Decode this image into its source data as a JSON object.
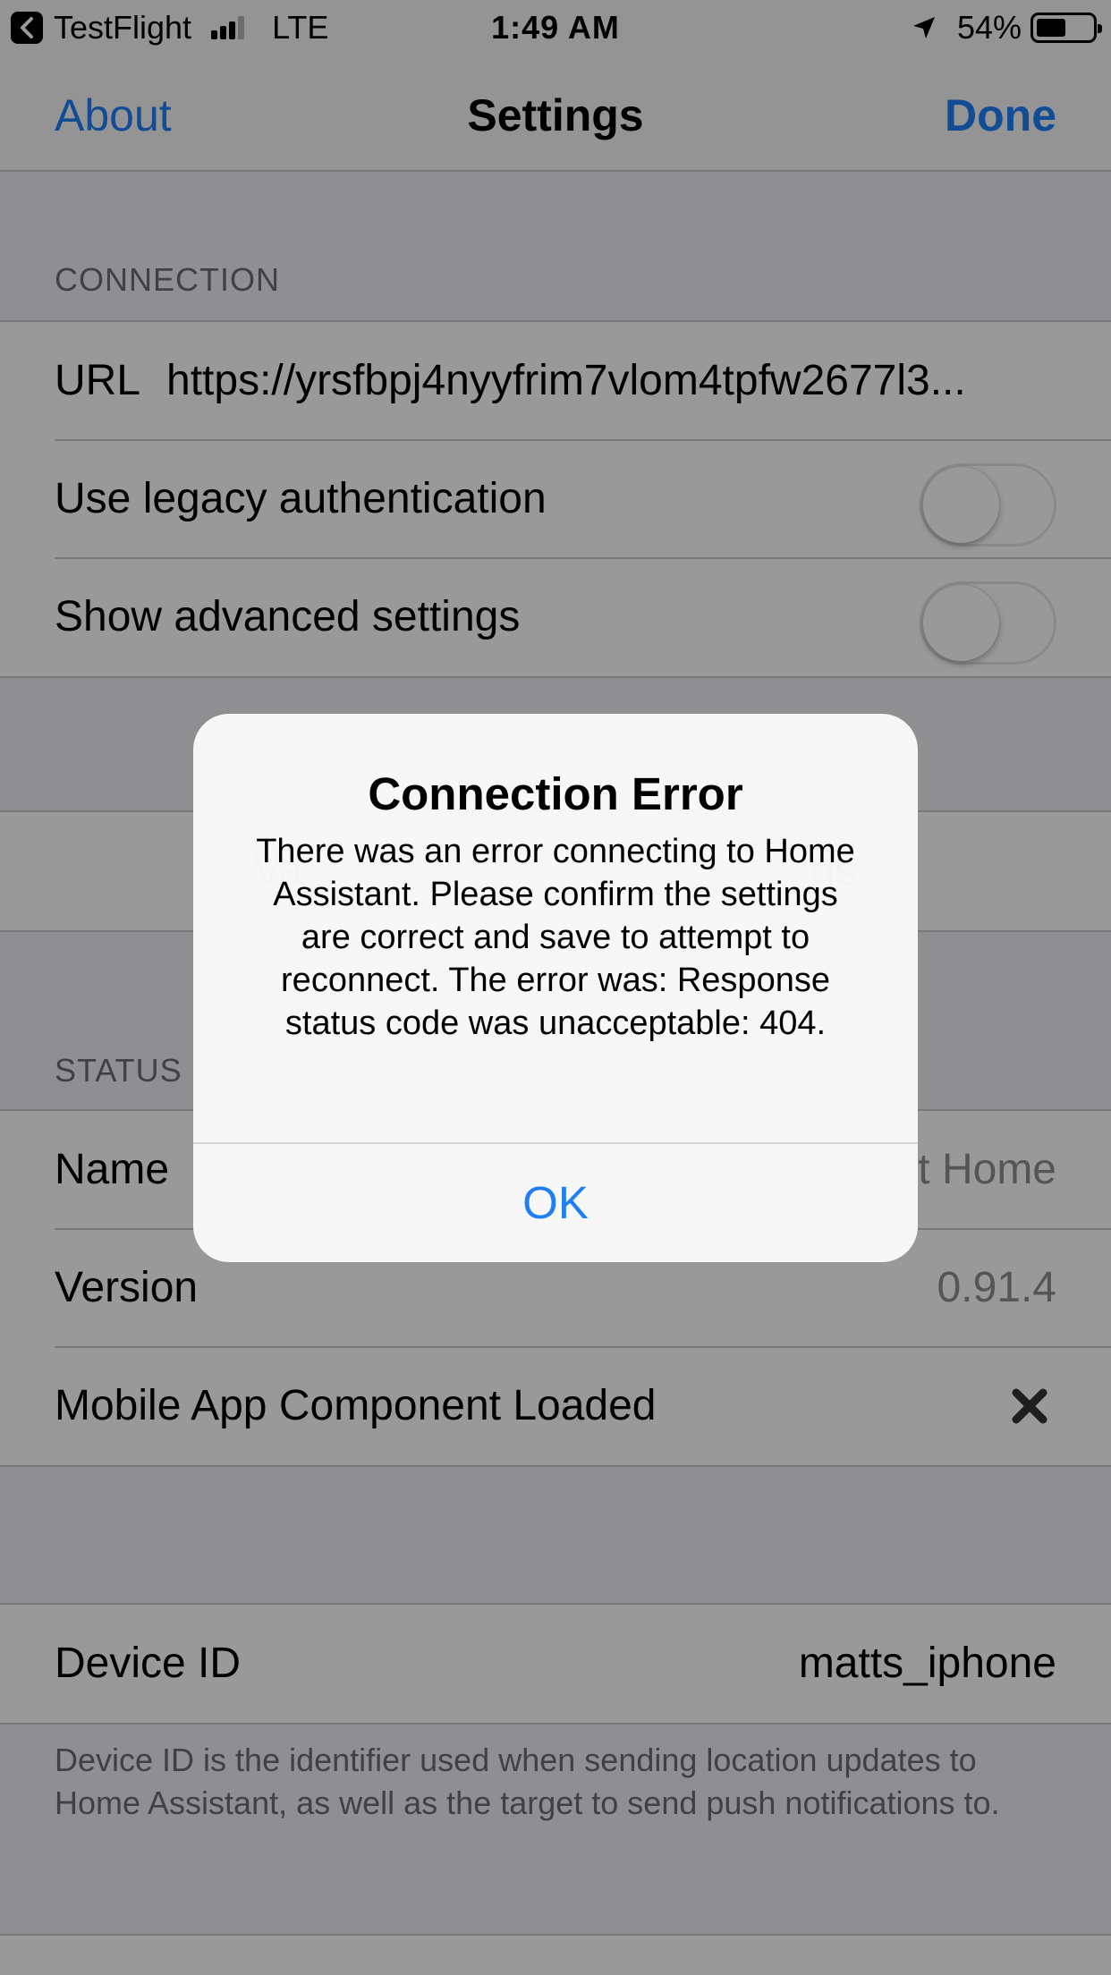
{
  "status_bar": {
    "back_app": "TestFlight",
    "network": "LTE",
    "time": "1:49 AM",
    "battery": "54%",
    "battery_level": 0.54
  },
  "nav": {
    "left": "About",
    "title": "Settings",
    "right": "Done"
  },
  "connection": {
    "header": "CONNECTION",
    "url_label": "URL",
    "url_value": "https://yrsfbpj4nyyfrim7vlom4tpfw2677l3...",
    "legacy_auth_label": "Use legacy authentication",
    "legacy_auth_on": false,
    "advanced_label": "Show advanced settings",
    "advanced_on": false
  },
  "buttons": {
    "left_label": "Va",
    "right_label": "gs"
  },
  "status": {
    "header": "STATUS",
    "name_label": "Name",
    "name_value": "t Home",
    "version_label": "Version",
    "version_value": "0.91.4",
    "component_label": "Mobile App Component Loaded"
  },
  "device": {
    "id_label": "Device ID",
    "id_value": "matts_iphone",
    "footer": "Device ID is the identifier used when sending location updates to Home Assistant, as well as the target to send push notifications to."
  },
  "alert": {
    "title": "Connection Error",
    "message": "There was an error connecting to Home Assistant. Please confirm the settings are correct and save to attempt to reconnect. The error was: Response status code was unacceptable: 404.",
    "ok": "OK"
  },
  "colors": {
    "accent": "#1e7ff8",
    "background": "#efeff4",
    "separator": "#c8c7cc"
  }
}
